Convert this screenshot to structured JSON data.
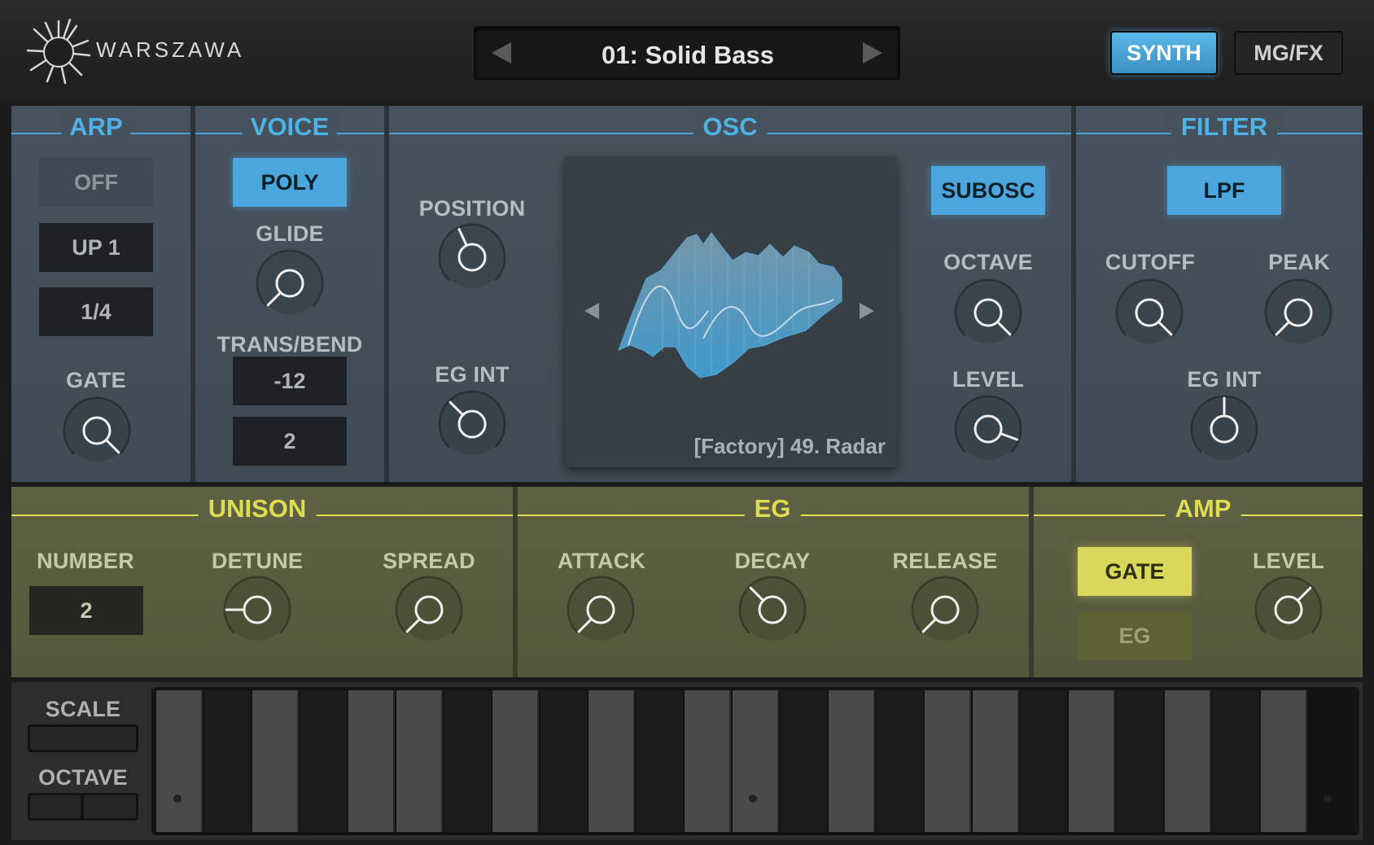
{
  "app": {
    "brand_name": "WARSZAWA",
    "preset_name": "01: Solid Bass",
    "tabs": [
      {
        "label": "SYNTH",
        "active": true
      },
      {
        "label": "MG/FX",
        "active": false
      }
    ]
  },
  "colors": {
    "accent_blue": "#4aa6dd",
    "accent_yellow": "#d9d85a",
    "panel_blue": "#4a5763",
    "panel_olive": "#5d5f42"
  },
  "arp": {
    "title": "ARP",
    "mode_label": "OFF",
    "pattern_label": "UP 1",
    "rate_label": "1/4",
    "gate_label": "GATE"
  },
  "voice": {
    "title": "VOICE",
    "mode_label": "POLY",
    "glide_label": "GLIDE",
    "transbend_label": "TRANS/BEND",
    "trans_value": "-12",
    "bend_value": "2"
  },
  "osc": {
    "title": "OSC",
    "position_label": "POSITION",
    "egint_label": "EG INT",
    "wavetable_name": "[Factory] 49. Radar",
    "subosc_label": "SUBOSC",
    "octave_label": "OCTAVE",
    "level_label": "LEVEL"
  },
  "filter": {
    "title": "FILTER",
    "type_label": "LPF",
    "cutoff_label": "CUTOFF",
    "peak_label": "PEAK",
    "egint_label": "EG INT"
  },
  "unison": {
    "title": "UNISON",
    "number_label": "NUMBER",
    "number_value": "2",
    "detune_label": "DETUNE",
    "spread_label": "SPREAD"
  },
  "eg": {
    "title": "EG",
    "attack_label": "ATTACK",
    "decay_label": "DECAY",
    "release_label": "RELEASE"
  },
  "amp": {
    "title": "AMP",
    "gate_label": "GATE",
    "eg_label": "EG",
    "level_label": "LEVEL"
  },
  "keyboard": {
    "scale_label": "SCALE",
    "octave_label": "OCTAVE"
  },
  "icons": {
    "prev": "triangle-left-icon",
    "next": "triangle-right-icon",
    "logo": "starburst-logo-icon"
  }
}
